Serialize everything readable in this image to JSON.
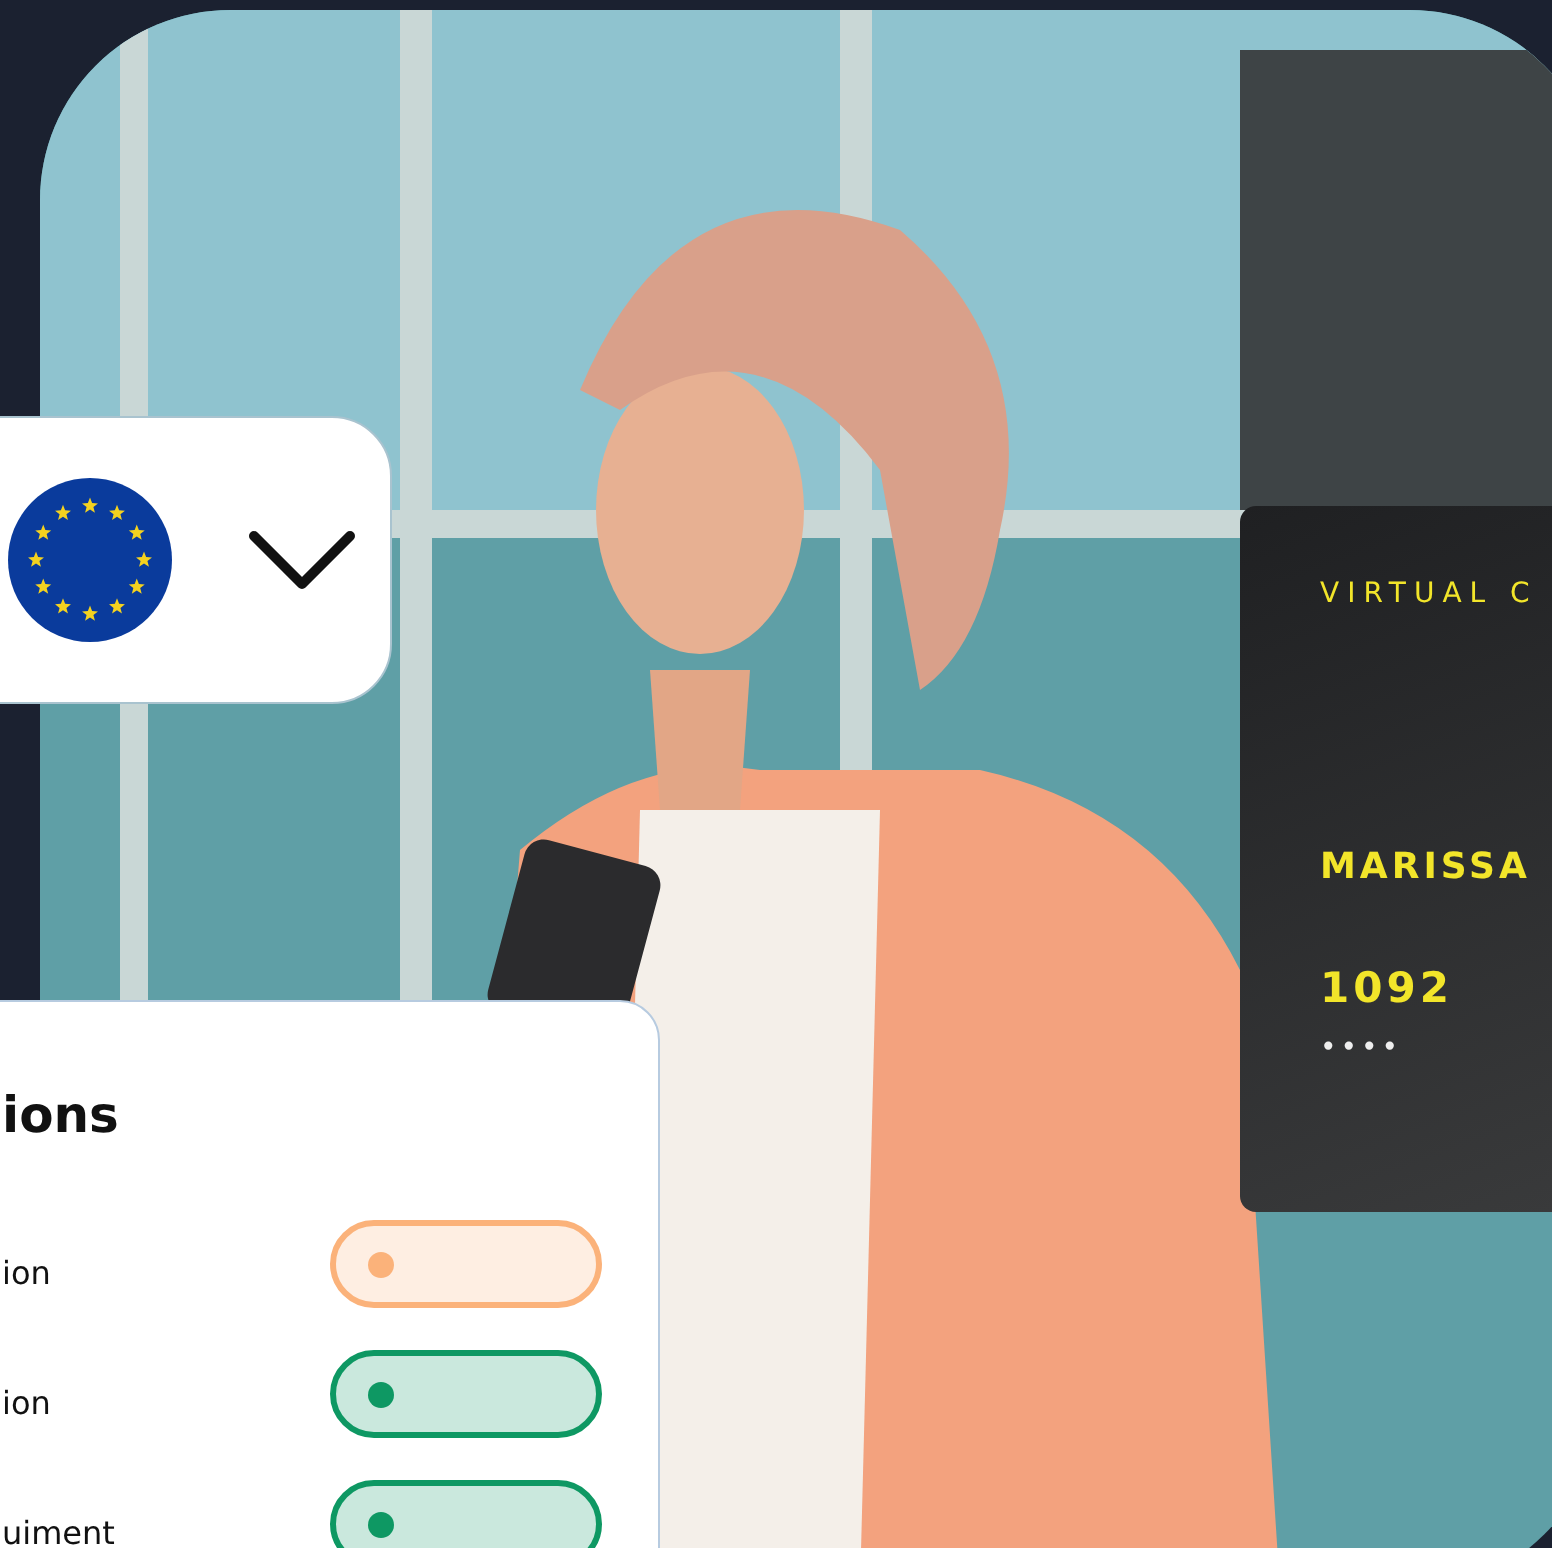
{
  "virtual_card": {
    "title": "VIRTUAL C",
    "name": "MARISSA",
    "number": "1092",
    "masked": "••••"
  },
  "options_card": {
    "title": "ions",
    "items": [
      {
        "label": "ion",
        "color": "#fbb27a"
      },
      {
        "label": "ion",
        "color": "#0e9863"
      },
      {
        "label": "uiment",
        "color": "#0e9863"
      }
    ]
  }
}
